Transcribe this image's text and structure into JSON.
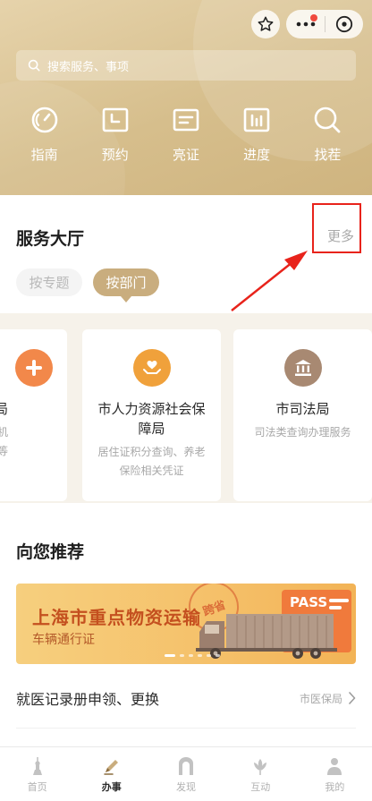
{
  "header": {
    "search_placeholder": "搜索服务、事项",
    "quick_actions": [
      {
        "label": "指南",
        "icon": "gauge-icon"
      },
      {
        "label": "预约",
        "icon": "calendar-clock-icon"
      },
      {
        "label": "亮证",
        "icon": "id-card-icon"
      },
      {
        "label": "进度",
        "icon": "progress-chart-icon"
      },
      {
        "label": "找茬",
        "icon": "search-icon"
      }
    ]
  },
  "hall": {
    "title": "服务大厅",
    "more": "更多",
    "tabs": [
      {
        "label": "按专题",
        "active": false
      },
      {
        "label": "按部门",
        "active": true
      }
    ],
    "cards": [
      {
        "name": "保障局",
        "desc": "、医疗机\n信息查询等",
        "icon": "plus-icon",
        "color": "#f2884a"
      },
      {
        "name": "市人力资源社会保障局",
        "desc": "居住证积分查询、养老保险相关凭证",
        "icon": "heart-hand-icon",
        "color": "#f0a13b"
      },
      {
        "name": "市司法局",
        "desc": "司法类查询办理服务",
        "icon": "court-building-icon",
        "color": "#a88972"
      }
    ]
  },
  "recommend": {
    "title": "向您推荐",
    "banner": {
      "title": "上海市重点物资运输",
      "subtitle": "车辆通行证",
      "stamp": "跨省",
      "pass": "PASS"
    },
    "item": {
      "title": "就医记录册申领、更换",
      "tag": "市医保局"
    }
  },
  "tabbar": [
    {
      "label": "首页",
      "icon": "pagoda-icon",
      "active": false
    },
    {
      "label": "办事",
      "icon": "pen-icon",
      "active": true
    },
    {
      "label": "发现",
      "icon": "gate-icon",
      "active": false
    },
    {
      "label": "互动",
      "icon": "magnolia-icon",
      "active": false
    },
    {
      "label": "我的",
      "icon": "user-icon",
      "active": false
    }
  ],
  "colors": {
    "header": "#d6be8c",
    "accent": "#c9ad7e",
    "annotation": "#e8231b"
  }
}
